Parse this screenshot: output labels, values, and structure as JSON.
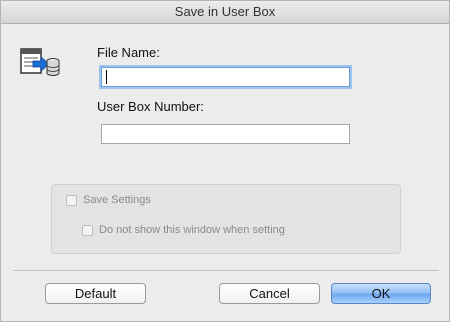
{
  "window": {
    "title": "Save in User Box"
  },
  "icon": "save-to-user-box-icon",
  "fields": {
    "file_name_label": "File Name:",
    "file_name_value": "",
    "user_box_label": "User Box Number:",
    "user_box_value": ""
  },
  "options": {
    "save_settings_label": "Save Settings",
    "save_settings_checked": false,
    "do_not_show_label": "Do not show this window when setting",
    "do_not_show_checked": false
  },
  "buttons": {
    "default_label": "Default",
    "cancel_label": "Cancel",
    "ok_label": "OK"
  },
  "colors": {
    "focus_ring": "#9fc3ef",
    "ok_button_accent": "#6aa6f0"
  }
}
